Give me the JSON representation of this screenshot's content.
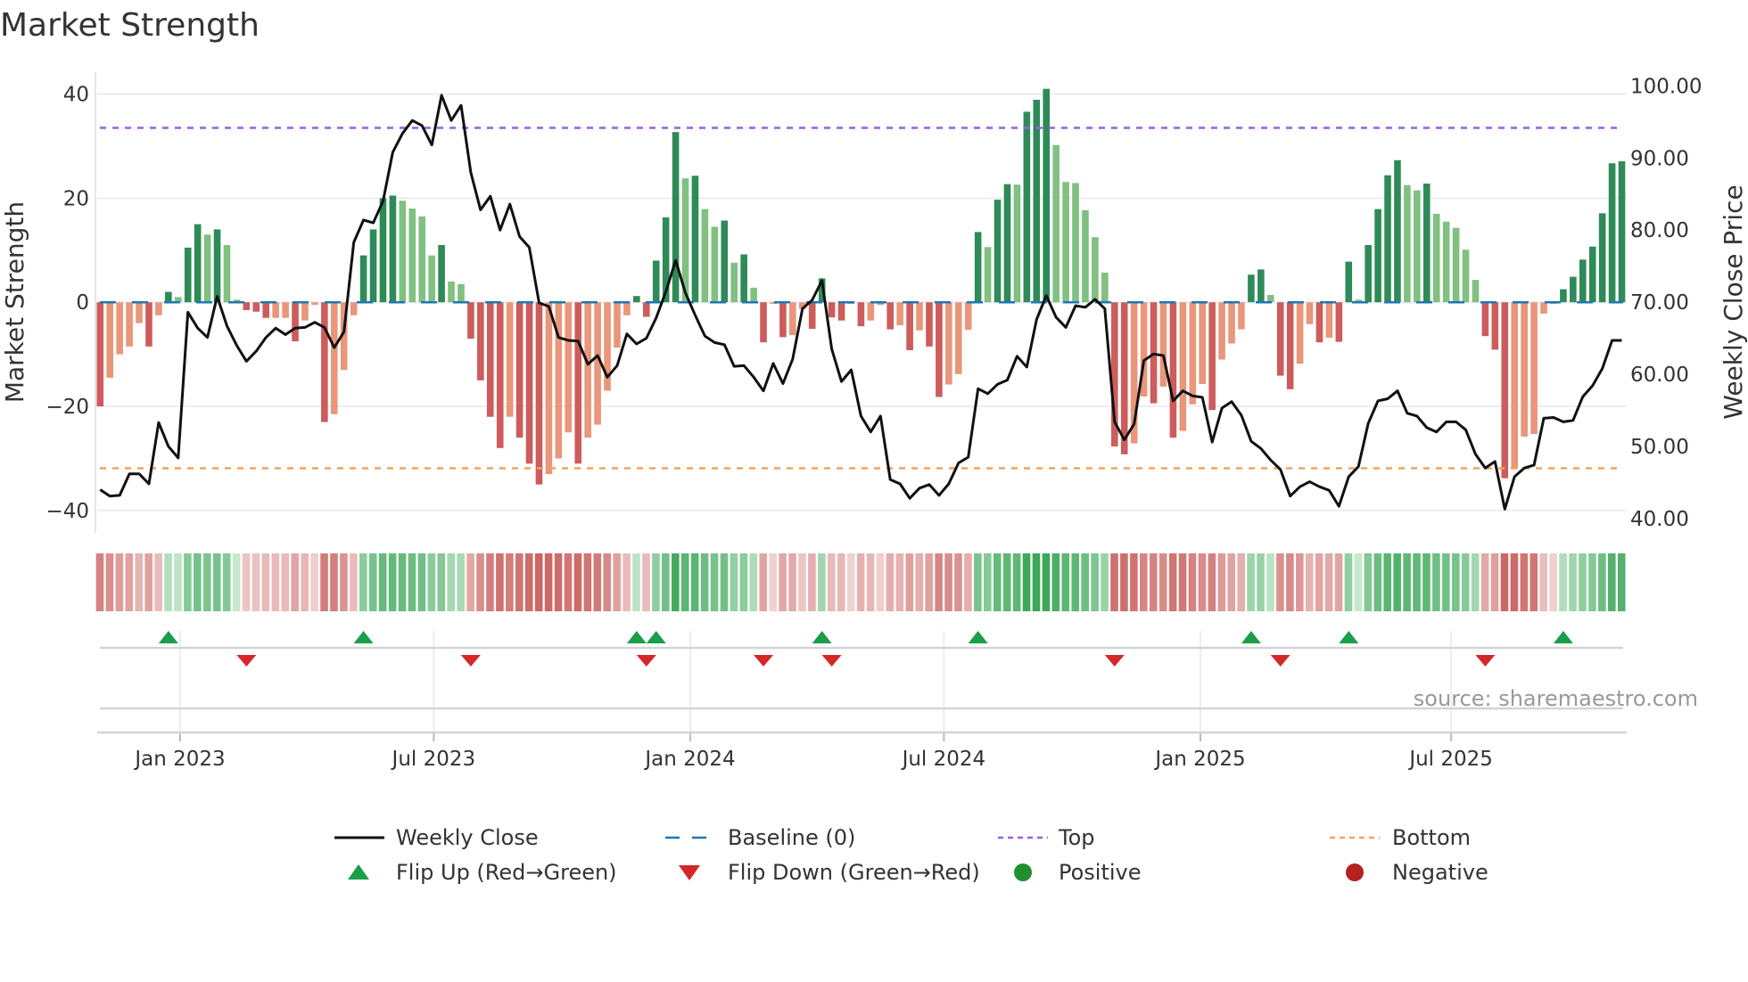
{
  "chart_data": {
    "type": "bar",
    "title": "Market Strength",
    "ylabel": "Market Strength",
    "y2label": "Weekly Close Price",
    "ylim": [
      -44.3,
      44.2
    ],
    "y2lim": [
      38.0,
      101.9
    ],
    "xlim": [
      -0.3,
      156.5
    ],
    "yticks": [
      {
        "v": 40,
        "label": "40"
      },
      {
        "v": 20,
        "label": "20"
      },
      {
        "v": 0,
        "label": "0"
      },
      {
        "v": -20,
        "label": "−20"
      },
      {
        "v": -40,
        "label": "−40"
      }
    ],
    "y2ticks": [
      {
        "v": 100,
        "label": "100.00"
      },
      {
        "v": 90,
        "label": "90.00"
      },
      {
        "v": 80,
        "label": "80.00"
      },
      {
        "v": 70,
        "label": "70.00"
      },
      {
        "v": 60,
        "label": "60.00"
      },
      {
        "v": 50,
        "label": "50.00"
      },
      {
        "v": 40,
        "label": "40.00"
      }
    ],
    "xticks": [
      {
        "v": 8.2,
        "label": "Jan 2023"
      },
      {
        "v": 34.2,
        "label": "Jul 2023"
      },
      {
        "v": 60.5,
        "label": "Jan 2024"
      },
      {
        "v": 86.5,
        "label": "Jul 2024"
      },
      {
        "v": 112.8,
        "label": "Jan 2025"
      },
      {
        "v": 138.5,
        "label": "Jul 2025"
      }
    ],
    "top_level": 33.5,
    "bottom_level": -31.9,
    "baseline": 0,
    "strength": [
      -20,
      -14.5,
      -10,
      -8.5,
      -4,
      -8.5,
      -2.5,
      2,
      1,
      10.5,
      15,
      13,
      14,
      11,
      0.5,
      -1.5,
      -1.8,
      -3,
      -3,
      -3,
      -7.5,
      -3.5,
      -0.5,
      -23,
      -21.5,
      -13,
      -2.5,
      9,
      14,
      20,
      20.5,
      19.5,
      18,
      16.5,
      9,
      11,
      4,
      3.5,
      -7,
      -15,
      -22,
      -28,
      -22,
      -26,
      -31,
      -35,
      -33,
      -30,
      -25,
      -31,
      -26,
      -23.5,
      -17,
      -8.7,
      -2.5,
      1.2,
      -2.8,
      8,
      16.3,
      32.7,
      23.8,
      24.3,
      17.9,
      14.5,
      15.7,
      7.6,
      9.2,
      2.8,
      -7.7,
      -0.3,
      -6.7,
      -6.3,
      -1.3,
      -5.1,
      4.6,
      -2.9,
      -3.5,
      -0.3,
      -4.6,
      -3.5,
      -0.5,
      -5.2,
      -4.4,
      -9.2,
      -5.4,
      -8.5,
      -18.2,
      -15.8,
      -13.8,
      -5.3,
      13.5,
      10.6,
      19.7,
      22.7,
      22.6,
      36.6,
      38.9,
      41,
      30.2,
      23.1,
      22.9,
      17.7,
      12.5,
      5.7,
      -27.7,
      -29.2,
      -27.1,
      -18.1,
      -19.4,
      -16.2,
      -26,
      -24.7,
      -19.6,
      -15.7,
      -20.7,
      -11,
      -7.9,
      -5.2,
      5.3,
      6.3,
      1.4,
      -14.1,
      -16.7,
      -11.8,
      -4.2,
      -7.7,
      -6.8,
      -7.6,
      7.8,
      0.5,
      11,
      17.9,
      24.4,
      27.3,
      22.5,
      21.5,
      22.8,
      17,
      15.5,
      14.3,
      10.1,
      4.3,
      -6.5,
      -9.1,
      -33.8,
      -32,
      -25.8,
      -25.3,
      -2.2,
      -0.3,
      2.5,
      4.9,
      8.2,
      10.7,
      17.1,
      26.7,
      27.1
    ],
    "weekly_close": [
      44,
      43.1,
      43.2,
      46.2,
      46.2,
      44.8,
      53.3,
      50,
      48.4,
      68.6,
      66.4,
      65.1,
      70.8,
      66.7,
      64,
      61.8,
      63.2,
      65.1,
      66.4,
      65.5,
      66.4,
      66.5,
      67.2,
      66.5,
      63.7,
      65.9,
      78.3,
      81.4,
      81,
      84,
      90.8,
      93.4,
      95.2,
      94.5,
      91.8,
      98.7,
      95.2,
      97.3,
      88,
      82.8,
      84.7,
      80,
      83.6,
      79.1,
      77.6,
      69.9,
      69.4,
      65.1,
      64.7,
      64.6,
      61.4,
      62.6,
      59.6,
      61.2,
      65.6,
      64.2,
      65,
      67.8,
      71.5,
      75.8,
      71.3,
      68.2,
      65.3,
      64.4,
      64.1,
      61.1,
      61.2,
      59.6,
      57.7,
      61.5,
      58.7,
      62.1,
      69.1,
      70.3,
      73,
      63.5,
      59,
      60.6,
      54.2,
      52,
      54.2,
      45.4,
      44.8,
      42.8,
      44.2,
      44.7,
      43.2,
      44.8,
      47.7,
      48.5,
      58,
      57.3,
      58.6,
      59.2,
      62.5,
      61,
      67.6,
      70.9,
      67.9,
      66.5,
      69.5,
      69.3,
      70.4,
      69.1,
      53.4,
      50.9,
      53.1,
      61.9,
      62.8,
      62.6,
      56.3,
      57.7,
      57,
      56.8,
      50.6,
      55.3,
      56.2,
      54.3,
      50.7,
      49.7,
      48.1,
      46.8,
      43.1,
      44.4,
      45.1,
      44.4,
      43.9,
      41.7,
      45.8,
      47.2,
      53.2,
      56.3,
      56.6,
      57.7,
      54.6,
      54.2,
      52.6,
      52,
      53.4,
      53.4,
      52.3,
      48.9,
      47,
      47.9,
      41.3,
      45.8,
      47,
      47.4,
      53.9,
      54,
      53.4,
      53.6,
      56.9,
      58.4,
      60.8,
      64.7,
      64.7
    ],
    "colors": {
      "up_strong": "#2e8b57",
      "up_weak": "#80c080",
      "down_strong": "#cd5c5c",
      "down_weak": "#e9967a",
      "close": "#111111",
      "baseline": "#1f77b4",
      "top": "#9b5de5",
      "bottom": "#f0a35e",
      "flip_up": "#1a9e4a",
      "flip_down": "#d62728",
      "positive": "#1f8f2f",
      "negative": "#b22222"
    },
    "legend": {
      "weekly_close": "Weekly Close",
      "baseline": "Baseline (0)",
      "top": "Top",
      "bottom": "Bottom",
      "flip_up": "Flip Up (Red→Green)",
      "flip_down": "Flip Down (Green→Red)",
      "positive": "Positive",
      "negative": "Negative"
    },
    "source": "source: sharemaestro.com"
  }
}
